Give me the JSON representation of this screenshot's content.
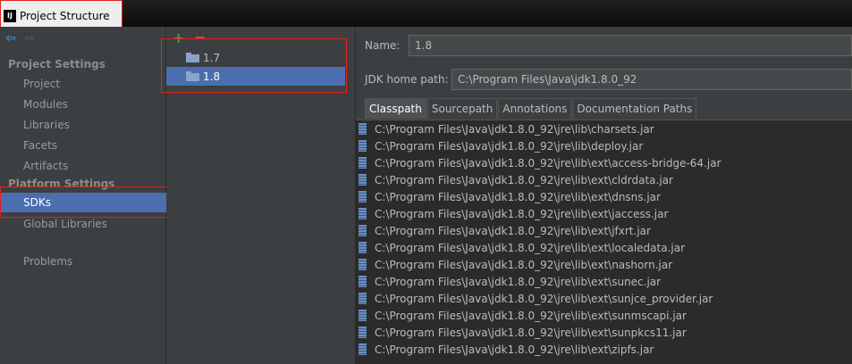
{
  "window": {
    "title": "Project Structure",
    "app_icon": "IJ"
  },
  "left_nav": {
    "project_settings_label": "Project Settings",
    "project_settings_items": [
      "Project",
      "Modules",
      "Libraries",
      "Facets",
      "Artifacts"
    ],
    "platform_settings_label": "Platform Settings",
    "sdks_label": "SDKs",
    "global_libraries_label": "Global Libraries",
    "problems_label": "Problems"
  },
  "sdk_list": {
    "add_icon": "+",
    "remove_icon": "−",
    "items": [
      {
        "name": "1.7",
        "selected": false
      },
      {
        "name": "1.8",
        "selected": true
      }
    ]
  },
  "detail": {
    "name_label": "Name:",
    "name_value": "1.8",
    "jdk_home_label": "JDK home path:",
    "jdk_home_value": "C:\\Program Files\\Java\\jdk1.8.0_92",
    "tabs": [
      "Classpath",
      "Sourcepath",
      "Annotations",
      "Documentation Paths"
    ],
    "active_tab": "Classpath",
    "classpath": [
      "C:\\Program Files\\Java\\jdk1.8.0_92\\jre\\lib\\charsets.jar",
      "C:\\Program Files\\Java\\jdk1.8.0_92\\jre\\lib\\deploy.jar",
      "C:\\Program Files\\Java\\jdk1.8.0_92\\jre\\lib\\ext\\access-bridge-64.jar",
      "C:\\Program Files\\Java\\jdk1.8.0_92\\jre\\lib\\ext\\cldrdata.jar",
      "C:\\Program Files\\Java\\jdk1.8.0_92\\jre\\lib\\ext\\dnsns.jar",
      "C:\\Program Files\\Java\\jdk1.8.0_92\\jre\\lib\\ext\\jaccess.jar",
      "C:\\Program Files\\Java\\jdk1.8.0_92\\jre\\lib\\ext\\jfxrt.jar",
      "C:\\Program Files\\Java\\jdk1.8.0_92\\jre\\lib\\ext\\localedata.jar",
      "C:\\Program Files\\Java\\jdk1.8.0_92\\jre\\lib\\ext\\nashorn.jar",
      "C:\\Program Files\\Java\\jdk1.8.0_92\\jre\\lib\\ext\\sunec.jar",
      "C:\\Program Files\\Java\\jdk1.8.0_92\\jre\\lib\\ext\\sunjce_provider.jar",
      "C:\\Program Files\\Java\\jdk1.8.0_92\\jre\\lib\\ext\\sunmscapi.jar",
      "C:\\Program Files\\Java\\jdk1.8.0_92\\jre\\lib\\ext\\sunpkcs11.jar",
      "C:\\Program Files\\Java\\jdk1.8.0_92\\jre\\lib\\ext\\zipfs.jar"
    ]
  },
  "colors": {
    "selection": "#4b6eaf",
    "highlight_box": "#e0221b",
    "background": "#3c3f41"
  }
}
